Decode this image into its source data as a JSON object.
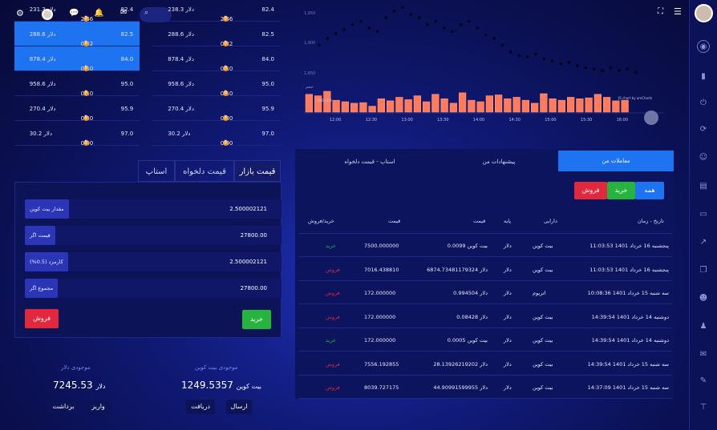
{
  "header": {
    "title_icons": [
      "gear-icon",
      "avatar",
      "chat-icon",
      "bell-icon",
      "mail-icon",
      "search-icon"
    ]
  },
  "orderbook_left": [
    {
      "total": "231.3 دلار",
      "amount": "2.66",
      "price": "82.4"
    },
    {
      "total": "288.6 دلار",
      "amount": "0.32",
      "price": "82.5"
    },
    {
      "total": "878.4 دلار",
      "amount": "0.10",
      "price": "84.0"
    },
    {
      "total": "958.6 دلار",
      "amount": "0.10",
      "price": "95.0"
    },
    {
      "total": "270.4 دلار",
      "amount": "0.30",
      "price": "95.9"
    },
    {
      "total": "30.2 دلار",
      "amount": "0.00",
      "price": "97.0"
    }
  ],
  "orderbook_right": [
    {
      "total": "238.3 دلار",
      "amount": "2.66",
      "price": "82.4"
    },
    {
      "total": "288.6 دلار",
      "amount": "0.32",
      "price": "82.5"
    },
    {
      "total": "878.4 دلار",
      "amount": "0.10",
      "price": "84.0"
    },
    {
      "total": "958.6 دلار",
      "amount": "0.10",
      "price": "95.0"
    },
    {
      "total": "270.4 دلار",
      "amount": "0.30",
      "price": "95.9"
    },
    {
      "total": "30.2 دلار",
      "amount": "0.00",
      "price": "97.0"
    }
  ],
  "form": {
    "tabs": [
      "قیمت بازار",
      "قیمت دلخواه",
      "استاپ"
    ],
    "fields": [
      {
        "label": "مقدار بیت کوین",
        "value": "2.500002121"
      },
      {
        "label": "قیمت اگر",
        "value": "27800.00"
      },
      {
        "label": "کارمزد (0.5%)",
        "value": "2.500002121"
      },
      {
        "label": "مجموع اگر",
        "value": "27800.00"
      }
    ],
    "buy": "خرید",
    "sell": "فروش"
  },
  "wallets": {
    "dollar": {
      "title": "موجودی دلار",
      "amount": "7245.53",
      "unit": "دلار",
      "b1": "واریز",
      "b2": "برداشت"
    },
    "btc": {
      "title": "موجودی بیت کوین",
      "amount": "1249.5357",
      "unit": "بیت کوین",
      "b1": "دریافت",
      "b2": "ارسال"
    }
  },
  "chart_data": {
    "type": "line",
    "ylabels": [
      "1,950",
      "1,900",
      "1,850"
    ],
    "volume_label": "حجم",
    "volume_tick": "200,000",
    "xlabels": [
      "12:00",
      "12:30",
      "13:00",
      "13:30",
      "14:00",
      "14:30",
      "15:00",
      "15:30",
      "16:00"
    ],
    "credit": "JS chart by amCharts",
    "series": [
      {
        "values": [
          1895,
          1905,
          1912,
          1918,
          1925,
          1930,
          1920,
          1915,
          1935,
          1945,
          1950,
          1940,
          1935,
          1925,
          1930,
          1920,
          1915,
          1925,
          1930,
          1920,
          1910,
          1905,
          1895,
          1885,
          1880,
          1878,
          1882,
          1875,
          1872,
          1868,
          1870,
          1865,
          1862,
          1860,
          1858,
          1862,
          1858,
          1860,
          1856
        ]
      }
    ],
    "volume": [
      60,
      55,
      70,
      40,
      35,
      30,
      32,
      20,
      45,
      38,
      50,
      42,
      55,
      35,
      60,
      45,
      30,
      65,
      40,
      35,
      55,
      58,
      45,
      50,
      40,
      30,
      62,
      45,
      40,
      50,
      45,
      48,
      60,
      50,
      38,
      40
    ]
  },
  "trades": {
    "tabs": [
      "معاملات من",
      "پیشنهادات من",
      "استاپ - قیمت دلخواه"
    ],
    "filters": [
      "همه",
      "خرید",
      "فروش"
    ],
    "headers": [
      "تاریخ - زمان",
      "دارایی",
      "پایه",
      "قیمت",
      "قیمت",
      "خرید/فروش"
    ],
    "rows": [
      {
        "date": "پنجشنبه 16 خرداد 1401 11:03:53",
        "asset": "بیت کوین",
        "base": "دلار",
        "amt": "0.0099 بیت کوین",
        "price": "7500.000000",
        "side": "خرید"
      },
      {
        "date": "پنجشنبه 16 خرداد 1401 11:03:53",
        "asset": "بیت کوین",
        "base": "دلار",
        "amt": "6874.73481179324 دلار",
        "price": "7016.438810",
        "side": "فروش"
      },
      {
        "date": "سه شنبه 15 خرداد 1401 10:08:36",
        "asset": "اتریوم",
        "base": "دلار",
        "amt": "0.994504 دلار",
        "price": "172.000000",
        "side": "فروش"
      },
      {
        "date": "دوشنبه 14 خرداد 1401 14:39:54",
        "asset": "بیت کوین",
        "base": "دلار",
        "amt": "0.08428 دلار",
        "price": "172.000000",
        "side": "فروش"
      },
      {
        "date": "دوشنبه 14 خرداد 1401 14:39:54",
        "asset": "بیت کوین",
        "base": "دلار",
        "amt": "0.0005 بیت کوین",
        "price": "172.000000",
        "side": "خرید"
      },
      {
        "date": "سه شنبه 15 خرداد 1401 14:39:54",
        "asset": "بیت کوین",
        "base": "دلار",
        "amt": "28.13926219202 دلار",
        "price": "7556.192855",
        "side": "فروش"
      },
      {
        "date": "سه شنبه 15 خرداد 1401 14:37:09",
        "asset": "بیت کوین",
        "base": "دلار",
        "amt": "44.90991599955 دلار",
        "price": "8039.727175",
        "side": "فروش"
      }
    ]
  },
  "colors": {
    "buy": "#27b43e",
    "sell": "#e2283d",
    "accent": "#1d73f0"
  }
}
